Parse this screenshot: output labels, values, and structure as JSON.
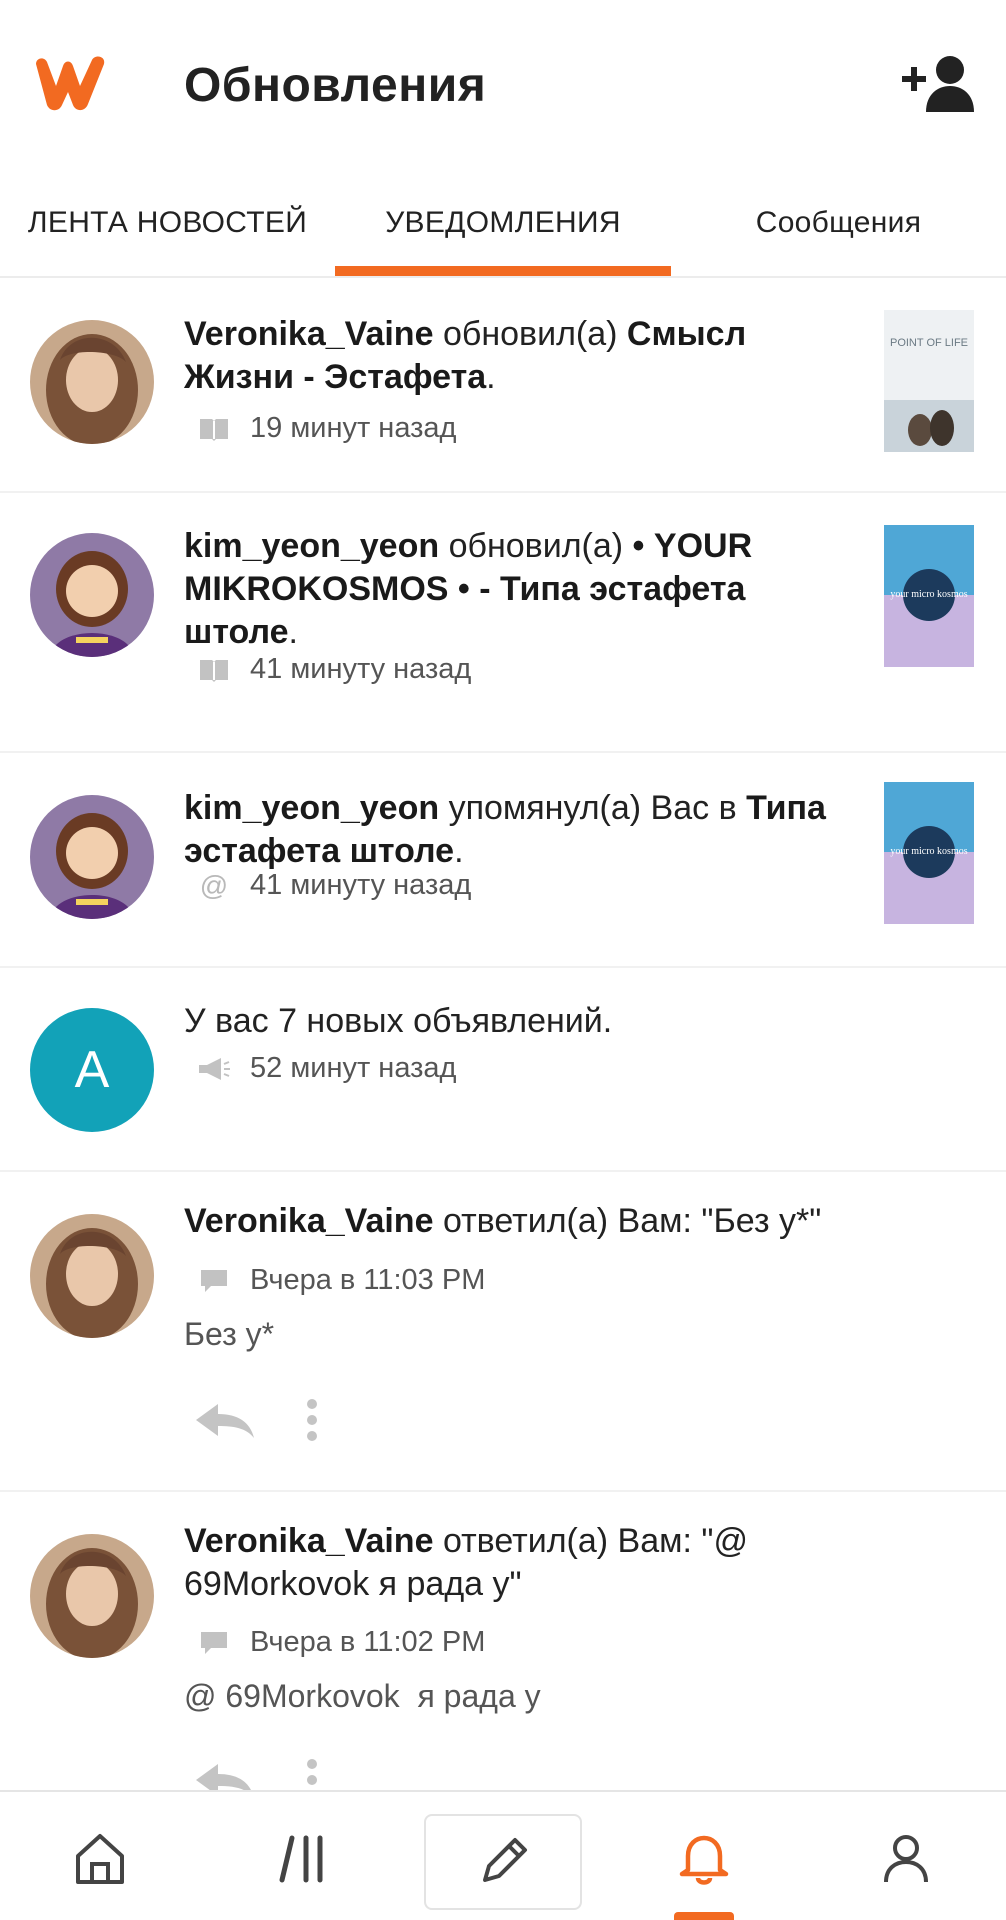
{
  "header": {
    "title": "Обновления",
    "brand_color": "#f26a21"
  },
  "tabs": [
    {
      "label": "ЛЕНТА НОВОСТЕЙ",
      "active": false
    },
    {
      "label": "УВЕДОМЛЕНИЯ",
      "active": true
    },
    {
      "label": "Сообщения",
      "active": false
    }
  ],
  "notifications": [
    {
      "user": "Veronika_Vaine",
      "action": " обновил(а) ",
      "target": "Смысл Жизни - Эстафета",
      "end": ".",
      "icon": "book-icon",
      "time": "19 минут назад",
      "thumb_text": "POINT OF LIFE"
    },
    {
      "user": "kim_yeon_yeon",
      "action": " обновил(а) ",
      "target": "• YOUR MIKROKOSMOS • - Типа эстафета штоле",
      "end": ".",
      "icon": "book-icon",
      "time": "41 минуту назад",
      "thumb_text": "your micro kosmos"
    },
    {
      "user": "kim_yeon_yeon",
      "action": " упомянул(а) Вас в ",
      "target": "Типа эстафета штоле",
      "end": ".",
      "icon": "at-icon",
      "time": "41 минуту назад",
      "thumb_text": "your micro kosmos"
    },
    {
      "avatar_letter": "A",
      "text": "У вас 7 новых объявлений.",
      "icon": "megaphone-icon",
      "time": "52 минут назад",
      "avatar_color": "#12a2b8"
    },
    {
      "user": "Veronika_Vaine",
      "action": " ответил(а) Вам: \"Без у*\"",
      "icon": "comment-icon",
      "time": "Вчера в 11:03 PM",
      "reply": "Без у*"
    },
    {
      "user": "Veronika_Vaine",
      "action": " ответил(а) Вам: \"@ 69Morkovok я рада у\"",
      "icon": "comment-icon",
      "time": "Вчера в 11:02 PM",
      "reply": "@ 69Morkovok  я рада у"
    }
  ],
  "bottom_nav": [
    {
      "name": "home",
      "icon": "home-icon"
    },
    {
      "name": "library",
      "icon": "library-icon"
    },
    {
      "name": "write",
      "icon": "pencil-icon"
    },
    {
      "name": "notifications",
      "icon": "bell-icon",
      "active": true
    },
    {
      "name": "profile",
      "icon": "profile-icon"
    }
  ]
}
